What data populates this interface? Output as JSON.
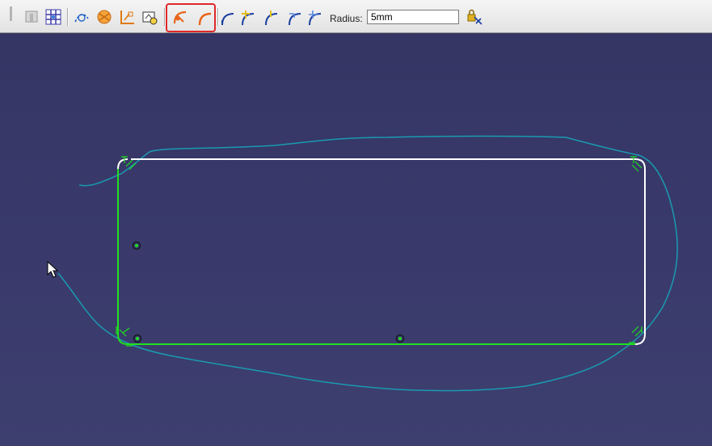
{
  "toolbar": {
    "radius_label": "Radius:",
    "radius_value": "5mm",
    "icons": [
      "grid-snap-icon",
      "construction-element-icon",
      "grid-icon",
      "geometrical-constraints-icon",
      "dimensional-constraints-icon",
      "corner-icon",
      "sketch-analysis-icon",
      "trim-mode-icon",
      "corner-fillet-icon",
      "fillet-no-trim-icon",
      "fillet-first-trim-icon",
      "fillet-both-trim-icon",
      "fillet-standard-icon",
      "fillet-construction-icon",
      "fillet-tangent-icon",
      "lock-constraint-icon"
    ]
  },
  "colors": {
    "background": "#363866",
    "toolbar": "#e8e8e8",
    "sketch_line_constrained": "#20e020",
    "sketch_line_selected": "#ffffff",
    "freehand_stroke": "#1a9ab0",
    "highlight_box": "#e02828"
  }
}
